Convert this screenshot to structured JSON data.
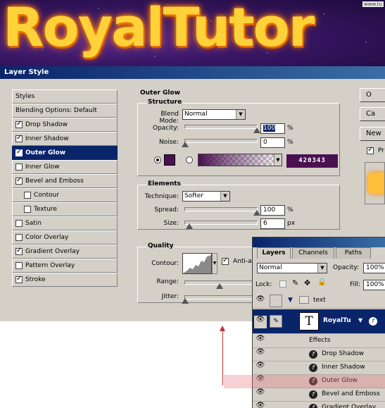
{
  "banner": {
    "title": "RoyalTutor",
    "watermark": "www.tu"
  },
  "dialog": {
    "title": "Layer Style"
  },
  "styles_list": {
    "header": "Styles",
    "blending": "Blending Options: Default",
    "items": [
      {
        "label": "Drop Shadow",
        "checked": true,
        "selected": false,
        "sub": false
      },
      {
        "label": "Inner Shadow",
        "checked": true,
        "selected": false,
        "sub": false
      },
      {
        "label": "Outer Glow",
        "checked": true,
        "selected": true,
        "sub": false
      },
      {
        "label": "Inner Glow",
        "checked": false,
        "selected": false,
        "sub": false
      },
      {
        "label": "Bevel and Emboss",
        "checked": true,
        "selected": false,
        "sub": false
      },
      {
        "label": "Contour",
        "checked": false,
        "selected": false,
        "sub": true
      },
      {
        "label": "Texture",
        "checked": false,
        "selected": false,
        "sub": true
      },
      {
        "label": "Satin",
        "checked": false,
        "selected": false,
        "sub": false
      },
      {
        "label": "Color Overlay",
        "checked": false,
        "selected": false,
        "sub": false
      },
      {
        "label": "Gradient Overlay",
        "checked": true,
        "selected": false,
        "sub": false
      },
      {
        "label": "Pattern Overlay",
        "checked": false,
        "selected": false,
        "sub": false
      },
      {
        "label": "Stroke",
        "checked": true,
        "selected": false,
        "sub": false
      }
    ]
  },
  "outer_glow": {
    "title": "Outer Glow",
    "structure": {
      "title": "Structure",
      "blend_mode_label": "Blend Mode:",
      "blend_mode": "Normal",
      "opacity_label": "Opacity:",
      "opacity": "100",
      "opacity_value": 100,
      "noise_label": "Noise:",
      "noise": "0",
      "noise_value": 0,
      "percent": "%",
      "color_hex": "420343",
      "color": "#4a1050"
    },
    "elements": {
      "title": "Elements",
      "technique_label": "Technique:",
      "technique": "Softer",
      "spread_label": "Spread:",
      "spread": "100",
      "spread_value": 100,
      "size_label": "Size:",
      "size": "6",
      "size_value": 6,
      "size_unit": "px",
      "percent": "%"
    },
    "quality": {
      "title": "Quality",
      "contour_label": "Contour:",
      "antialias_label": "Anti-a",
      "range_label": "Range:",
      "jitter_label": "Jitter:"
    }
  },
  "buttons": {
    "ok": "O",
    "cancel": "Ca",
    "new_style": "New",
    "preview": "Pr"
  },
  "layers_panel": {
    "tabs": [
      "Layers",
      "Channels",
      "Paths"
    ],
    "blend_mode": "Normal",
    "opacity_label": "Opacity:",
    "opacity": "100%",
    "lock_label": "Lock:",
    "fill_label": "Fill:",
    "fill": "100%",
    "folder_name": "text",
    "layer_name": "RoyalTu",
    "layer_thumb": "T",
    "effects_label": "Effects",
    "effects": [
      "Drop Shadow",
      "Inner Shadow",
      "Outer Glow",
      "Bevel and Emboss",
      "Gradient Overlay"
    ]
  }
}
